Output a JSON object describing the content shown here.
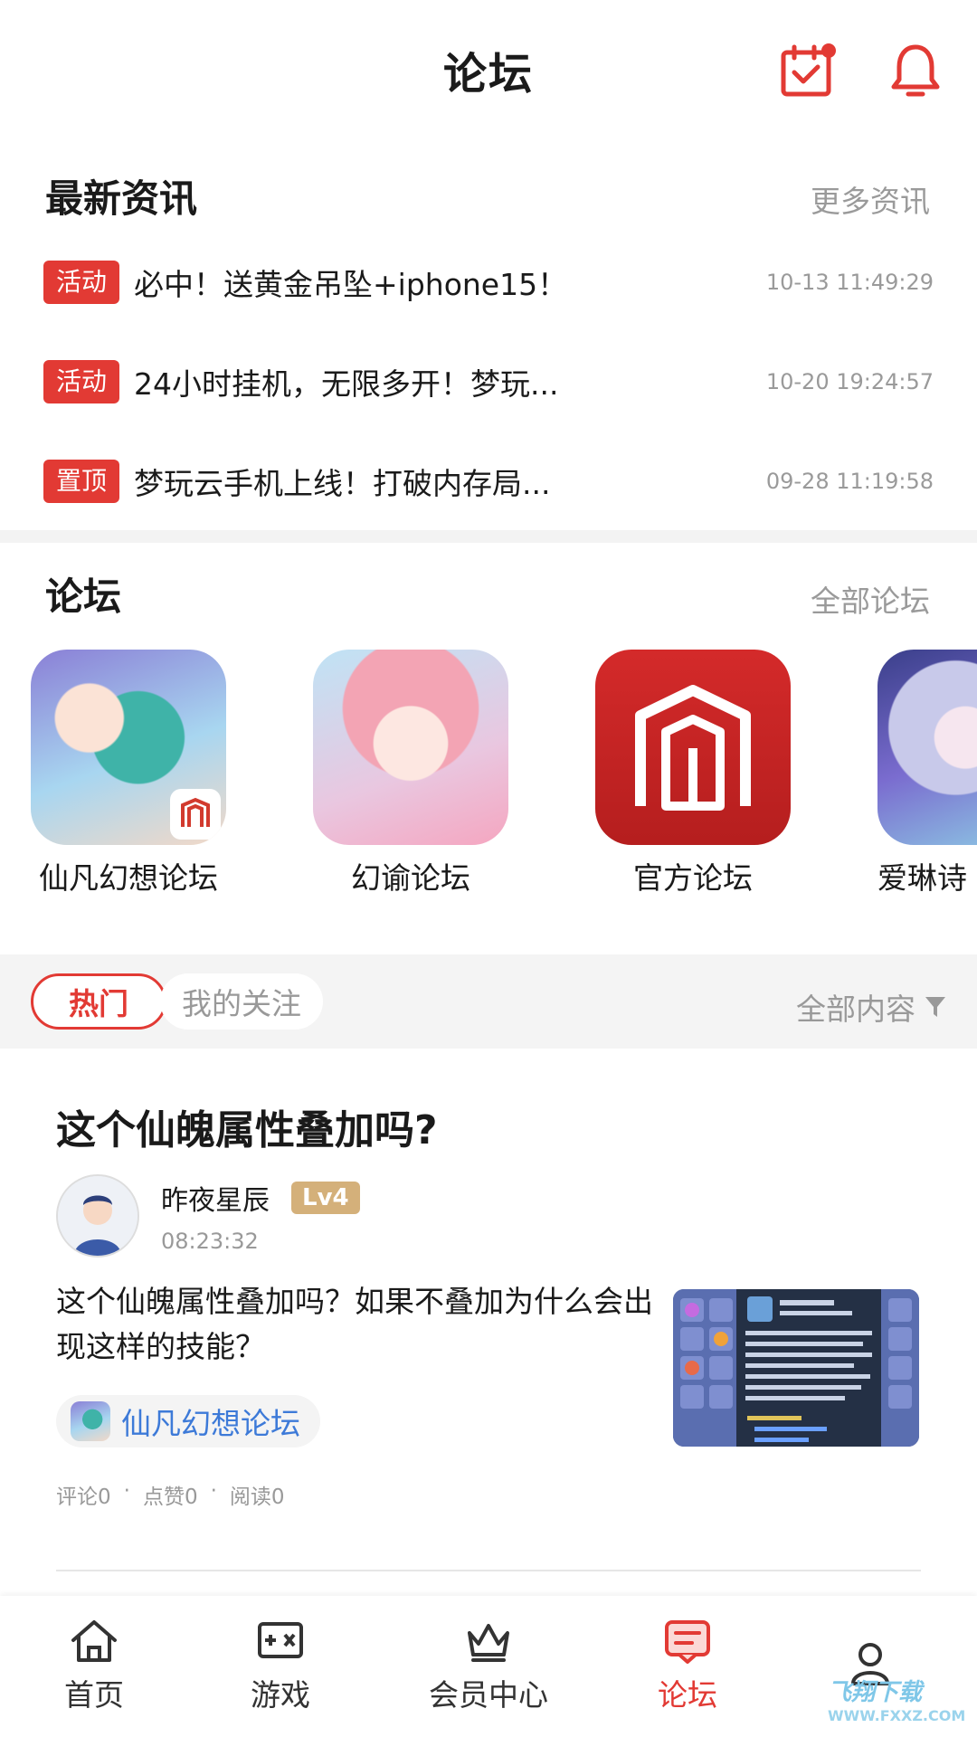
{
  "header": {
    "title": "论坛",
    "checkin_icon": "calendar-check-icon",
    "bell_icon": "bell-icon",
    "accent": "#e23a34"
  },
  "news": {
    "title": "最新资讯",
    "more": "更多资讯",
    "items": [
      {
        "tag": "活动",
        "title": "必中！送黄金吊坠+iphone15！",
        "time": "10-13 11:49:29"
      },
      {
        "tag": "活动",
        "title": "24小时挂机，无限多开！梦玩...",
        "time": "10-20 19:24:57"
      },
      {
        "tag": "置顶",
        "title": "梦玩云手机上线！打破内存局...",
        "time": "09-28 11:19:58"
      }
    ]
  },
  "forums": {
    "title": "论坛",
    "more": "全部论坛",
    "items": [
      {
        "name": "仙凡幻想论坛"
      },
      {
        "name": "幻谕论坛"
      },
      {
        "name": "官方论坛"
      },
      {
        "name": "爱琳诗"
      }
    ]
  },
  "filter": {
    "hot": "热门",
    "following": "我的关注",
    "all": "全部内容",
    "filter_icon": "funnel-icon"
  },
  "post": {
    "title": "这个仙魄属性叠加吗?",
    "author": "昨夜星辰",
    "level": "Lv4",
    "time": "08:23:32",
    "body": "这个仙魄属性叠加吗？如果不叠加为什么会出现这样的技能？",
    "forum": "仙凡幻想论坛",
    "comments": "评论0",
    "likes": "点赞0",
    "reads": "阅读0",
    "dot": "·"
  },
  "nav": [
    {
      "label": "首页",
      "icon": "home-icon"
    },
    {
      "label": "游戏",
      "icon": "gamepad-icon"
    },
    {
      "label": "会员中心",
      "icon": "crown-icon"
    },
    {
      "label": "论坛",
      "icon": "forum-icon",
      "active": true
    },
    {
      "label": "",
      "icon": "user-icon"
    }
  ],
  "watermark": {
    "text": "飞翔下载",
    "sub": "WWW.FXXZ.COM"
  }
}
